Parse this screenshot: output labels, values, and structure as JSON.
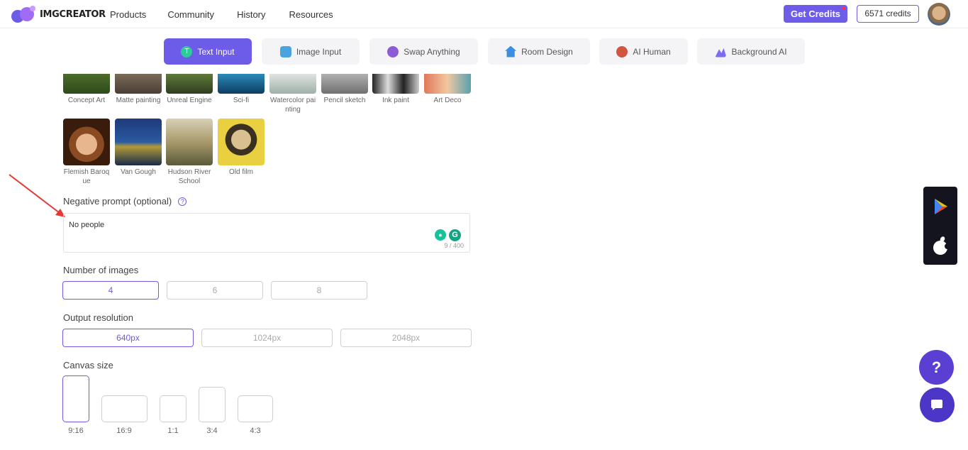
{
  "header": {
    "logo_text": "IMGCREATOR",
    "nav": [
      "Products",
      "Community",
      "History",
      "Resources"
    ],
    "get_credits": "Get Credits",
    "credits": "6571 credits"
  },
  "tabs": [
    {
      "label": "Text Input",
      "active": true,
      "icon": "text-icon",
      "color": "#6c5ce7"
    },
    {
      "label": "Image Input",
      "active": false,
      "icon": "image-icon",
      "color": "#4aa3df"
    },
    {
      "label": "Swap Anything",
      "active": false,
      "icon": "palette-icon",
      "color": "#8e5bd6"
    },
    {
      "label": "Room Design",
      "active": false,
      "icon": "house-icon",
      "color": "#3b8fe0"
    },
    {
      "label": "AI Human",
      "active": false,
      "icon": "face-icon",
      "color": "#d2553f"
    },
    {
      "label": "Background AI",
      "active": false,
      "icon": "mountain-icon",
      "color": "#7b6cf0"
    }
  ],
  "styles_row1": [
    "Concept Art",
    "Matte painting",
    "Unreal Engine",
    "Sci-fi",
    "Watercolor painting",
    "Pencil sketch",
    "Ink paint",
    "Art Deco"
  ],
  "styles_row2": [
    "Flemish Baroque",
    "Van Gough",
    "Hudson River School",
    "Old film"
  ],
  "negative_prompt": {
    "label": "Negative prompt (optional)",
    "value": "No people",
    "counter": "9 / 400"
  },
  "number_of_images": {
    "label": "Number of images",
    "options": [
      "4",
      "6",
      "8"
    ],
    "selected": "4"
  },
  "output_resolution": {
    "label": "Output resolution",
    "options": [
      "640px",
      "1024px",
      "2048px"
    ],
    "selected": "640px"
  },
  "canvas_size": {
    "label": "Canvas size",
    "options": [
      "9:16",
      "16:9",
      "1:1",
      "3:4",
      "4:3"
    ],
    "selected": "9:16"
  },
  "help_fab": "?",
  "accent_color": "#6c5ce7"
}
